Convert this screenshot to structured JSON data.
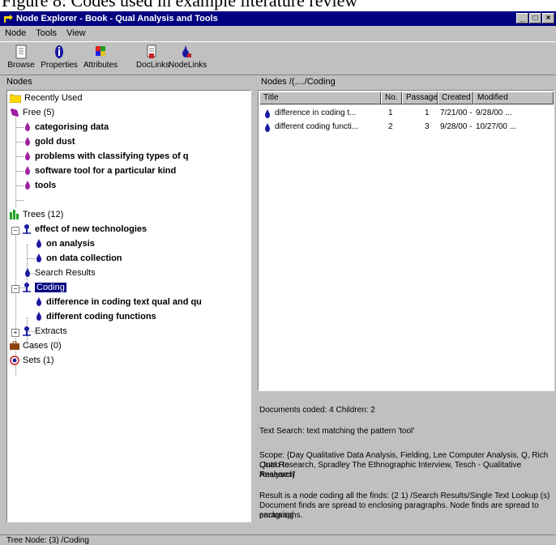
{
  "caption": "Figure 8: Codes used in example literature review",
  "window": {
    "title": "Node Explorer - Book - Qual Analysis and Tools",
    "buttons": {
      "minimize": "_",
      "maximize": "□",
      "close": "×"
    }
  },
  "menu": [
    "Node",
    "Tools",
    "View"
  ],
  "toolbar": [
    {
      "icon": "browse-icon",
      "label": "Browse"
    },
    {
      "icon": "properties-icon",
      "label": "Properties"
    },
    {
      "icon": "attributes-icon",
      "label": "Attributes"
    },
    {
      "icon": "doclinks-icon",
      "label": "DocLinks"
    },
    {
      "icon": "nodelinks-icon",
      "label": "NodeLinks"
    }
  ],
  "left_header": "Nodes",
  "tree": {
    "recently_used": "Recently Used",
    "free": "Free (5)",
    "free_items": [
      "categorising data",
      "gold dust",
      "problems with classifying types of q",
      "software tool for a particular kind",
      "tools"
    ],
    "trees": "Trees (12)",
    "effect_of_new": "effect of new technologies",
    "on_analysis": "on analysis",
    "on_data_collection": "on data collection",
    "search_results": "Search Results",
    "coding": "Coding",
    "difference_in_coding": "difference in coding text qual and qu",
    "different_coding": "different coding functions",
    "extracts": "Extracts",
    "cases": "Cases (0)",
    "sets": "Sets (1)"
  },
  "right_header": "Nodes /(..../Coding",
  "table": {
    "columns": [
      "Title",
      "No.",
      "Passages",
      "Created",
      "Modified"
    ],
    "rows": [
      {
        "title": "difference in coding t...",
        "no": "1",
        "passages": "1",
        "created": "7/21/00 - ...",
        "modified": "9/28/00 ..."
      },
      {
        "title": "different coding functi...",
        "no": "2",
        "passages": "3",
        "created": "9/28/00 - ...",
        "modified": "10/27/00 ..."
      }
    ]
  },
  "info": {
    "line1": "Documents coded: 4 Children: 2",
    "line2": "Text Search: text matching the pattern 'tool'",
    "line3": "Scope: {Day Qualitative Data Analysis, Fielding, Lee Computer Analysis, Q, Rich : Intro to",
    "line4": "Qual Research, Spradley The Ethnographic Interview, Tesch - Qualitative Research'",
    "line5": "Analyses}",
    "line6": "Result is a node coding all the finds: (2 1) /Search Results/Single Text Lookup (s)",
    "line7": "Document finds are spread to enclosing paragraphs. Node finds are spread to enclosing",
    "line8": "paragraphs."
  },
  "status": "Tree Node: (3) /Coding",
  "colors": {
    "titlebar": "#000080",
    "face": "#c0c0c0",
    "selection": "#000080"
  }
}
